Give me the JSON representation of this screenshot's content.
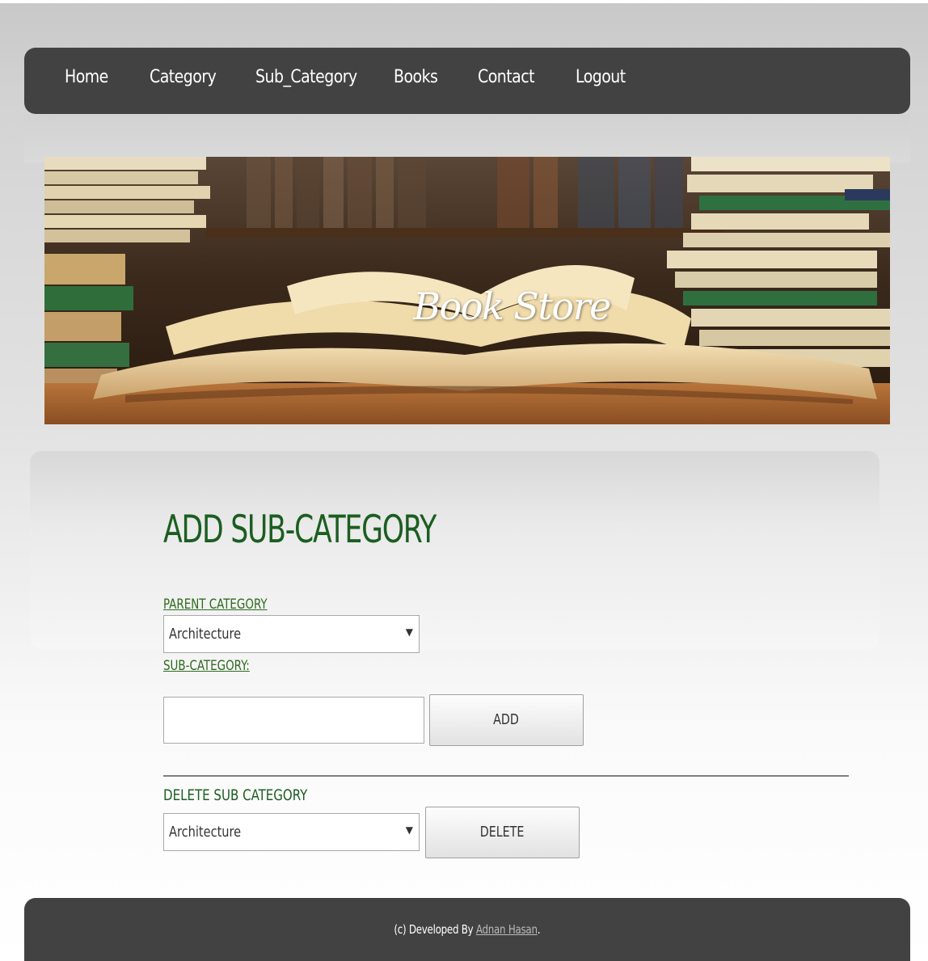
{
  "nav": {
    "items": [
      {
        "label": "Home"
      },
      {
        "label": "Category"
      },
      {
        "label": "Sub_Category"
      },
      {
        "label": "Books"
      },
      {
        "label": "Contact"
      },
      {
        "label": "Logout"
      }
    ]
  },
  "banner": {
    "title": "Book Store"
  },
  "main": {
    "heading": "ADD SUB-CATEGORY",
    "parent_category_label": "PARENT CATEGORY ",
    "parent_category_selected": "Architecture",
    "sub_category_label": "SUB-CATEGORY:",
    "sub_category_value": "",
    "add_button": "ADD",
    "delete_label": "DELETE SUB CATEGORY",
    "delete_selected": "Architecture",
    "delete_button": "DELETE"
  },
  "footer": {
    "prefix": "(c) Developed By ",
    "author": "Adnan Hasan",
    "suffix": "."
  },
  "colors": {
    "nav_bg": "#424242",
    "heading": "#1b5e20",
    "label": "#2e6b1f",
    "footer_link": "#b9b9b9"
  }
}
